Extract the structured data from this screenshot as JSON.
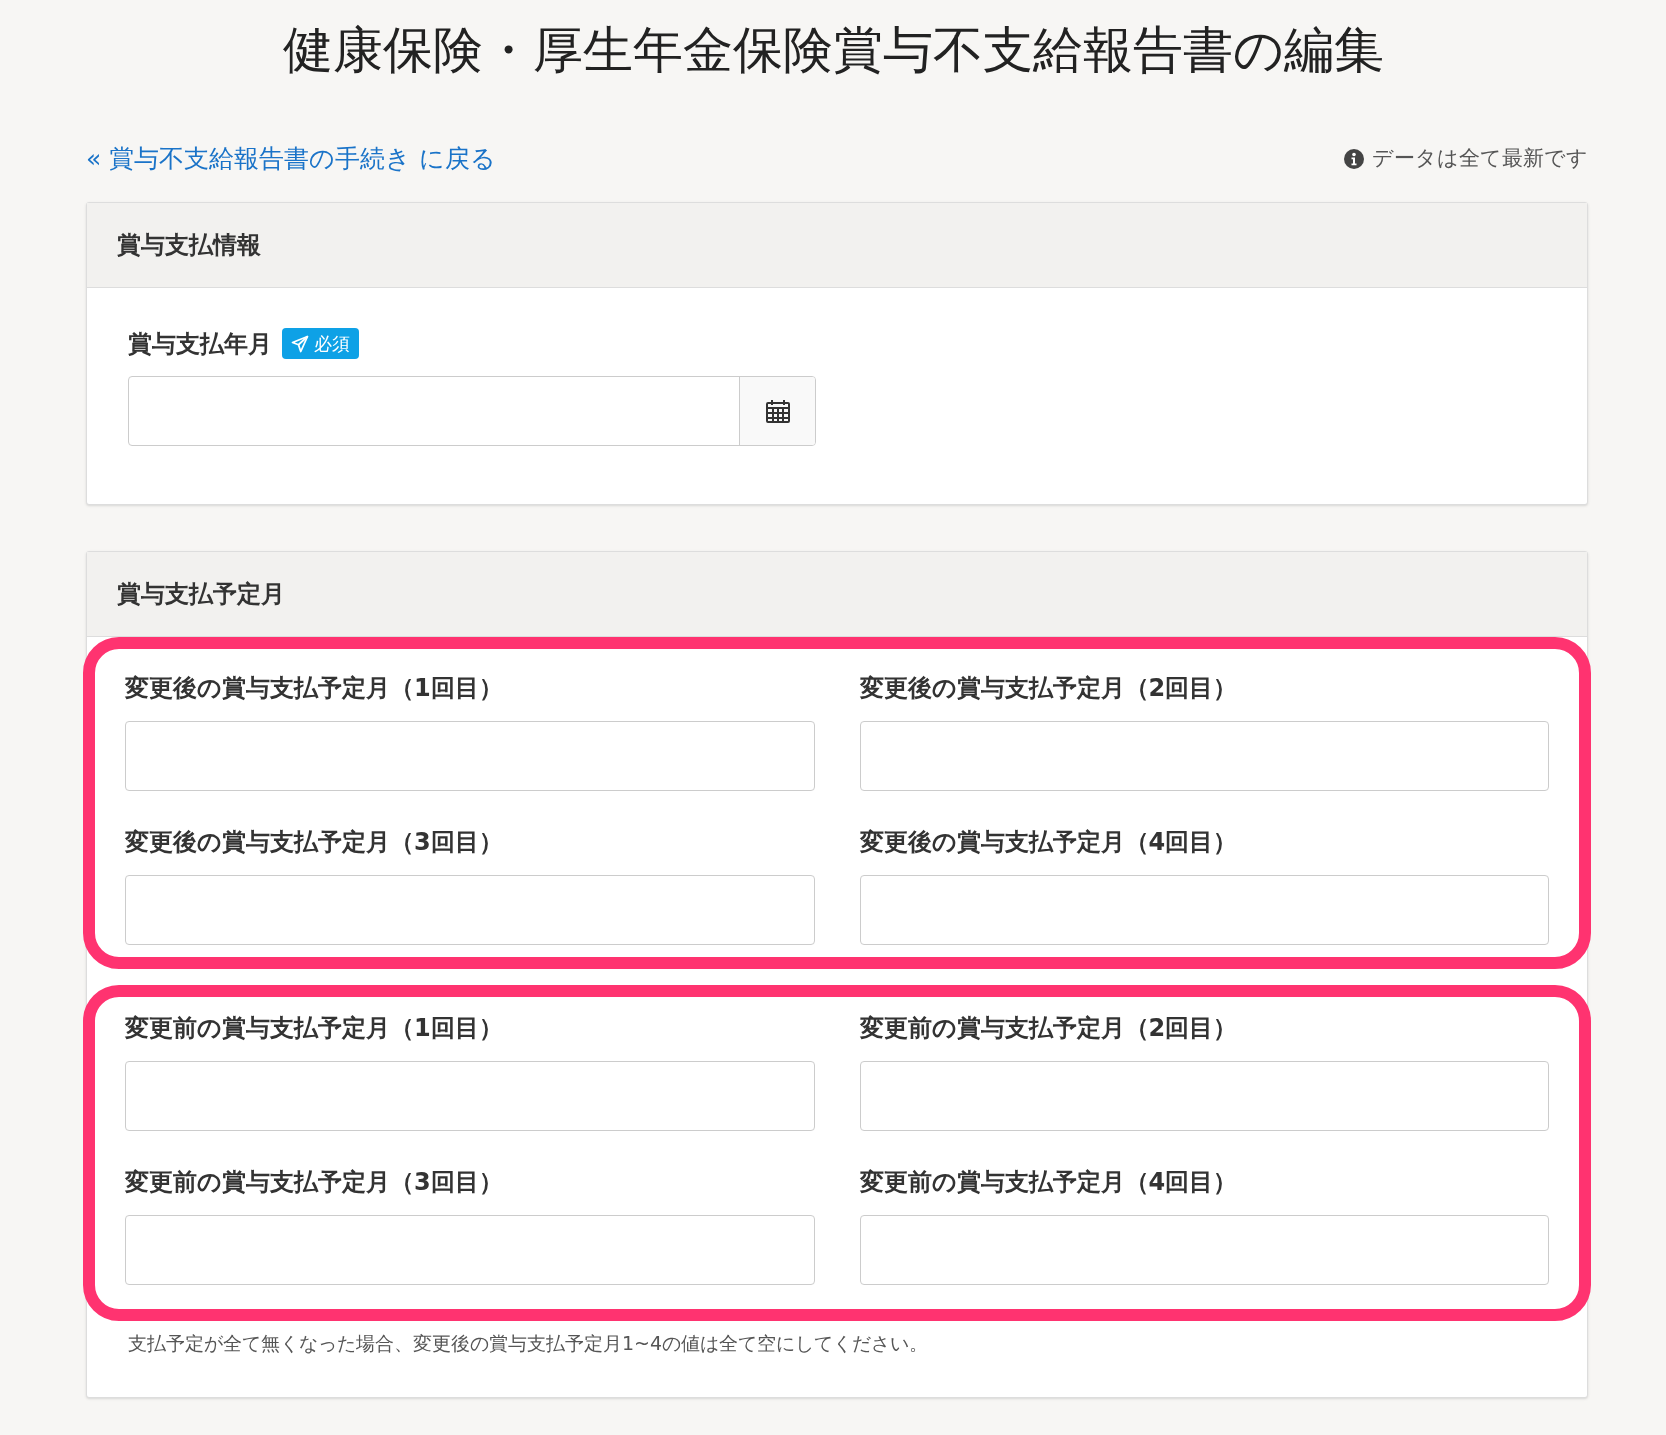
{
  "title": "健康保険・厚生年金保険賞与不支給報告書の編集",
  "back_link": "« 賞与不支給報告書の手続き に戻る",
  "status": {
    "text": "データは全て最新です"
  },
  "payment_info": {
    "heading": "賞与支払情報",
    "field": {
      "label": "賞与支払年月",
      "badge": "必須"
    }
  },
  "schedule": {
    "heading": "賞与支払予定月",
    "groups": [
      {
        "highlighted": true,
        "fields": [
          {
            "label": "変更後の賞与支払予定月（1回目）"
          },
          {
            "label": "変更後の賞与支払予定月（2回目）"
          },
          {
            "label": "変更後の賞与支払予定月（3回目）"
          },
          {
            "label": "変更後の賞与支払予定月（4回目）"
          }
        ]
      },
      {
        "highlighted": true,
        "fields": [
          {
            "label": "変更前の賞与支払予定月（1回目）"
          },
          {
            "label": "変更前の賞与支払予定月（2回目）"
          },
          {
            "label": "変更前の賞与支払予定月（3回目）"
          },
          {
            "label": "変更前の賞与支払予定月（4回目）"
          }
        ]
      }
    ],
    "note": "支払予定が全て無くなった場合、変更後の賞与支払予定月1~4の値は全て空にしてください。"
  }
}
